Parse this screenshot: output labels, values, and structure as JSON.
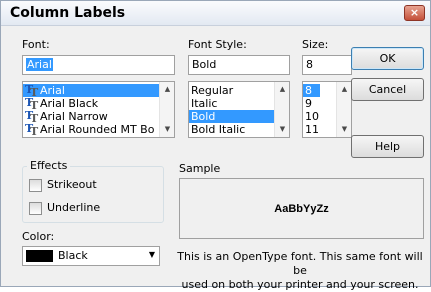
{
  "window": {
    "title": "Column Labels",
    "close_label": "×"
  },
  "font": {
    "label": "Font:",
    "value": "Arial",
    "items": [
      "Arial",
      "Arial Black",
      "Arial Narrow",
      "Arial Rounded MT Bo"
    ],
    "selected": "Arial"
  },
  "style": {
    "label": "Font Style:",
    "value": "Bold",
    "items": [
      "Regular",
      "Italic",
      "Bold",
      "Bold Italic"
    ],
    "selected": "Bold"
  },
  "size": {
    "label": "Size:",
    "value": "8",
    "items": [
      "8",
      "9",
      "10",
      "11"
    ],
    "selected": "8"
  },
  "buttons": {
    "ok": "OK",
    "cancel": "Cancel",
    "help": "Help"
  },
  "effects": {
    "label": "Effects",
    "strikeout": "Strikeout",
    "underline": "Underline"
  },
  "color": {
    "label": "Color:",
    "value": "Black",
    "swatch": "#000000"
  },
  "sample": {
    "label": "Sample",
    "text": "AaBbYyZz"
  },
  "description": {
    "line1": "This is an OpenType font. This same font will be",
    "line2": "used on both your printer and your screen."
  },
  "icons": {
    "font_type": "opentype-font-icon",
    "scroll_up": "scroll-up-arrow",
    "scroll_down": "scroll-down-arrow",
    "dropdown": "dropdown-arrow"
  }
}
